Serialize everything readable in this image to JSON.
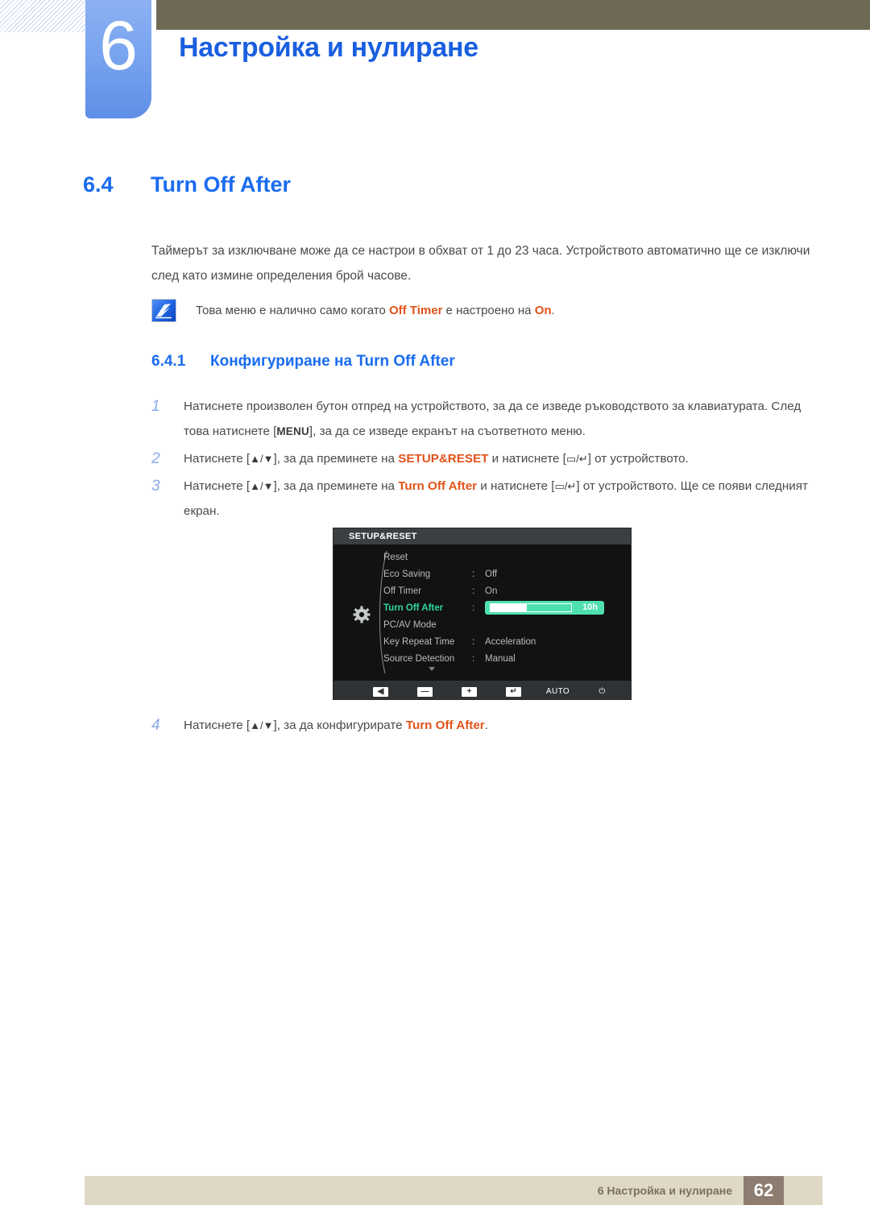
{
  "chapter": {
    "number": "6",
    "title": "Настройка и нулиране"
  },
  "section": {
    "number": "6.4",
    "title": "Turn Off After"
  },
  "paragraph": "Таймерът за изключване може да се настрои в обхват от 1 до 23 часа. Устройството автоматично ще се изключи след като измине определения брой часове.",
  "note": {
    "icon": "note-pen-icon",
    "prefix": "Това меню е налично само когато ",
    "highlight1": "Off Timer",
    "middle": " е настроено на ",
    "highlight2": "On",
    "suffix": "."
  },
  "subsection": {
    "number": "6.4.1",
    "title": "Конфигуриране на Turn Off After"
  },
  "steps": [
    {
      "marker": "1",
      "parts": [
        {
          "type": "text",
          "value": "Натиснете произволен бутон отпред на устройството, за да се изведе ръководството за клавиатурата. След това натиснете ["
        },
        {
          "type": "key",
          "value": "MENU"
        },
        {
          "type": "text",
          "value": "], за да се изведе екранът на съответното меню."
        }
      ]
    },
    {
      "marker": "2",
      "parts": [
        {
          "type": "text",
          "value": "Натиснете ["
        },
        {
          "type": "arrows",
          "value": "▲/▼"
        },
        {
          "type": "text",
          "value": "], за да преминете на "
        },
        {
          "type": "orange",
          "value": "SETUP&RESET"
        },
        {
          "type": "text",
          "value": " и натиснете ["
        },
        {
          "type": "glyph",
          "value": "▭/↵"
        },
        {
          "type": "text",
          "value": "] от устройството."
        }
      ]
    },
    {
      "marker": "3",
      "parts": [
        {
          "type": "text",
          "value": "Натиснете ["
        },
        {
          "type": "arrows",
          "value": "▲/▼"
        },
        {
          "type": "text",
          "value": "], за да преминете на "
        },
        {
          "type": "orange",
          "value": "Turn Off After"
        },
        {
          "type": "text",
          "value": " и натиснете ["
        },
        {
          "type": "glyph",
          "value": "▭/↵"
        },
        {
          "type": "text",
          "value": "] от устройството. Ще се появи следният екран."
        }
      ]
    },
    {
      "marker": "4",
      "parts": [
        {
          "type": "text",
          "value": "Натиснете ["
        },
        {
          "type": "arrows",
          "value": "▲/▼"
        },
        {
          "type": "text",
          "value": "], за да конфигурирате "
        },
        {
          "type": "orange",
          "value": "Turn Off After"
        },
        {
          "type": "text",
          "value": "."
        }
      ]
    }
  ],
  "osd": {
    "title": "SETUP&RESET",
    "gear_icon": "gear-icon",
    "items": [
      {
        "label": "Reset",
        "colon": "",
        "value": "",
        "selected": false,
        "type": "plain"
      },
      {
        "label": "Eco Saving",
        "colon": ":",
        "value": "Off",
        "selected": false,
        "type": "plain"
      },
      {
        "label": "Off Timer",
        "colon": ":",
        "value": "On",
        "selected": false,
        "type": "plain"
      },
      {
        "label": "Turn Off After",
        "colon": ":",
        "value": "10h",
        "selected": true,
        "type": "slider",
        "fill_percent": 45
      },
      {
        "label": "PC/AV Mode",
        "colon": "",
        "value": "",
        "selected": false,
        "type": "submenu"
      },
      {
        "label": "Key Repeat Time",
        "colon": ":",
        "value": "Acceleration",
        "selected": false,
        "type": "plain"
      },
      {
        "label": "Source Detection",
        "colon": ":",
        "value": "Manual",
        "selected": false,
        "type": "plain"
      }
    ],
    "buttons": [
      {
        "name": "left-arrow-button",
        "glyph": "◀",
        "style": "square"
      },
      {
        "name": "minus-button",
        "glyph": "—",
        "style": "square"
      },
      {
        "name": "plus-button",
        "glyph": "+",
        "style": "square"
      },
      {
        "name": "enter-button",
        "glyph": "↵",
        "style": "square"
      },
      {
        "name": "auto-button",
        "glyph": "AUTO",
        "style": "text"
      },
      {
        "name": "power-button",
        "glyph": "⏻",
        "style": "text"
      }
    ],
    "accent_green": "#4ee0b0",
    "label_green": "#2fd79e"
  },
  "footer": {
    "text": "6 Настройка и нулиране",
    "page": "62"
  }
}
